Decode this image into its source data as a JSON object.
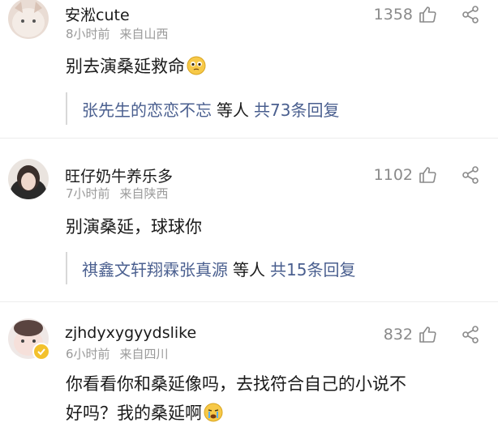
{
  "comments": [
    {
      "name": "安淞cute",
      "time": "8小时前",
      "location": "来自山西",
      "likes": "1358",
      "text": "别去演桑延救命",
      "emoji": "pleading-face",
      "reply_users": "张先生的恋恋不忘",
      "reply_mid": "等人",
      "reply_count": "共73条回复"
    },
    {
      "name": "旺仔奶牛养乐多",
      "time": "7小时前",
      "location": "来自陕西",
      "likes": "1102",
      "text": "别演桑延，球球你",
      "reply_users": "祺鑫文轩翔霖张真源",
      "reply_mid": "等人",
      "reply_count": "共15条回复"
    },
    {
      "name": "zjhdyxygyydslike",
      "time": "6小时前",
      "location": "来自四川",
      "likes": "832",
      "text_line1": "你看看你和桑延像吗，去找符合自己的小说不",
      "text_line2": "好吗？我的桑延啊",
      "emoji": "crying-face"
    }
  ],
  "colors": {
    "reply_link": "#4a5f8f",
    "meta_gray": "#9a9a9a",
    "badge_gold": "#f3c12c"
  }
}
